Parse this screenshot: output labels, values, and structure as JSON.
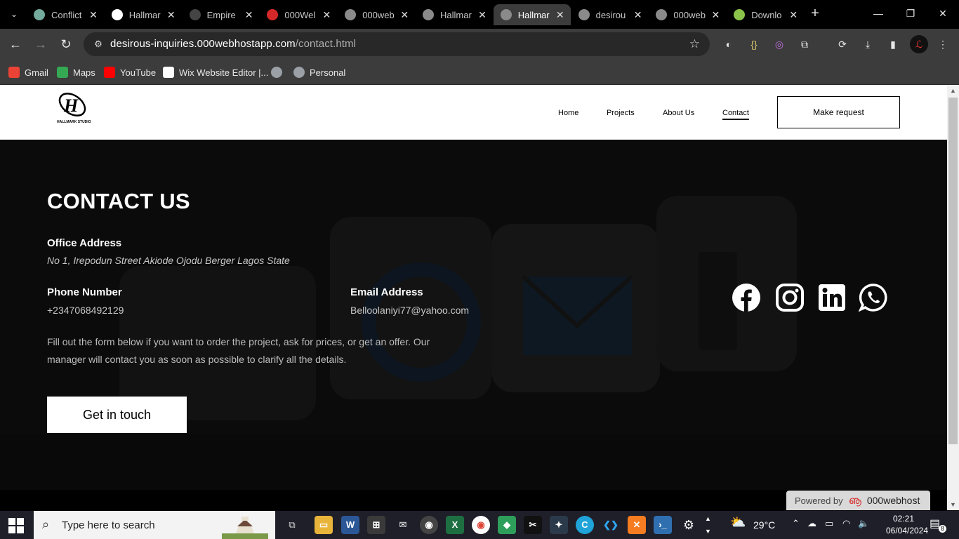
{
  "browser": {
    "tabs": [
      {
        "title": "Conflict",
        "color": "#74aa9c"
      },
      {
        "title": "Hallmar",
        "color": "#ffffff"
      },
      {
        "title": "Empire",
        "color": "#444444"
      },
      {
        "title": "000Wel",
        "color": "#d62828"
      },
      {
        "title": "000web",
        "color": "#8a8a8a"
      },
      {
        "title": "Hallmar",
        "color": "#8a8a8a"
      },
      {
        "title": "Hallmar",
        "color": "#8a8a8a",
        "active": true
      },
      {
        "title": "desirou",
        "color": "#8a8a8a"
      },
      {
        "title": "000web",
        "color": "#8a8a8a"
      },
      {
        "title": "Downlo",
        "color": "#8bc34a"
      }
    ],
    "close_glyph": "✕",
    "new_tab": "+",
    "url_host": "desirous-inquiries.000webhostapp.com",
    "url_path": "/contact.html",
    "bookmarks": [
      {
        "label": "Gmail",
        "color": "#ea4335"
      },
      {
        "label": "Maps",
        "color": "#34a853"
      },
      {
        "label": "YouTube",
        "color": "#ff0000"
      },
      {
        "label": "Wix Website Editor |...",
        "color": "#ffffff"
      },
      {
        "label": "",
        "color": "#9aa0a6"
      },
      {
        "label": "Personal",
        "color": "#9aa0a6"
      }
    ]
  },
  "site": {
    "nav": [
      "Home",
      "Projects",
      "About Us",
      "Contact"
    ],
    "cta": "Make request",
    "heading": "CONTACT US",
    "office_label": "Office Address",
    "office_value": "No 1, Irepodun Street Akiode Ojodu Berger Lagos State",
    "phone_label": "Phone Number",
    "phone_value": "+2347068492129",
    "email_label": "Email Address",
    "email_value": "Belloolaniyi77@yahoo.com",
    "paragraph": "Fill out the form below if you want to order the project, ask for prices, or get an offer. Our manager will contact you as soon as possible to clarify all the details.",
    "button": "Get in touch",
    "social_icons": [
      "facebook-icon",
      "instagram-icon",
      "linkedin-icon",
      "whatsapp-icon"
    ],
    "logo_text": "HALLMARK STUDIO"
  },
  "badge": {
    "powered": "Powered by",
    "brand": "000webhost"
  },
  "taskbar": {
    "search_placeholder": "Type here to search",
    "weather": "29°C",
    "time": "02:21",
    "date": "06/04/2024",
    "notification_count": "8"
  }
}
